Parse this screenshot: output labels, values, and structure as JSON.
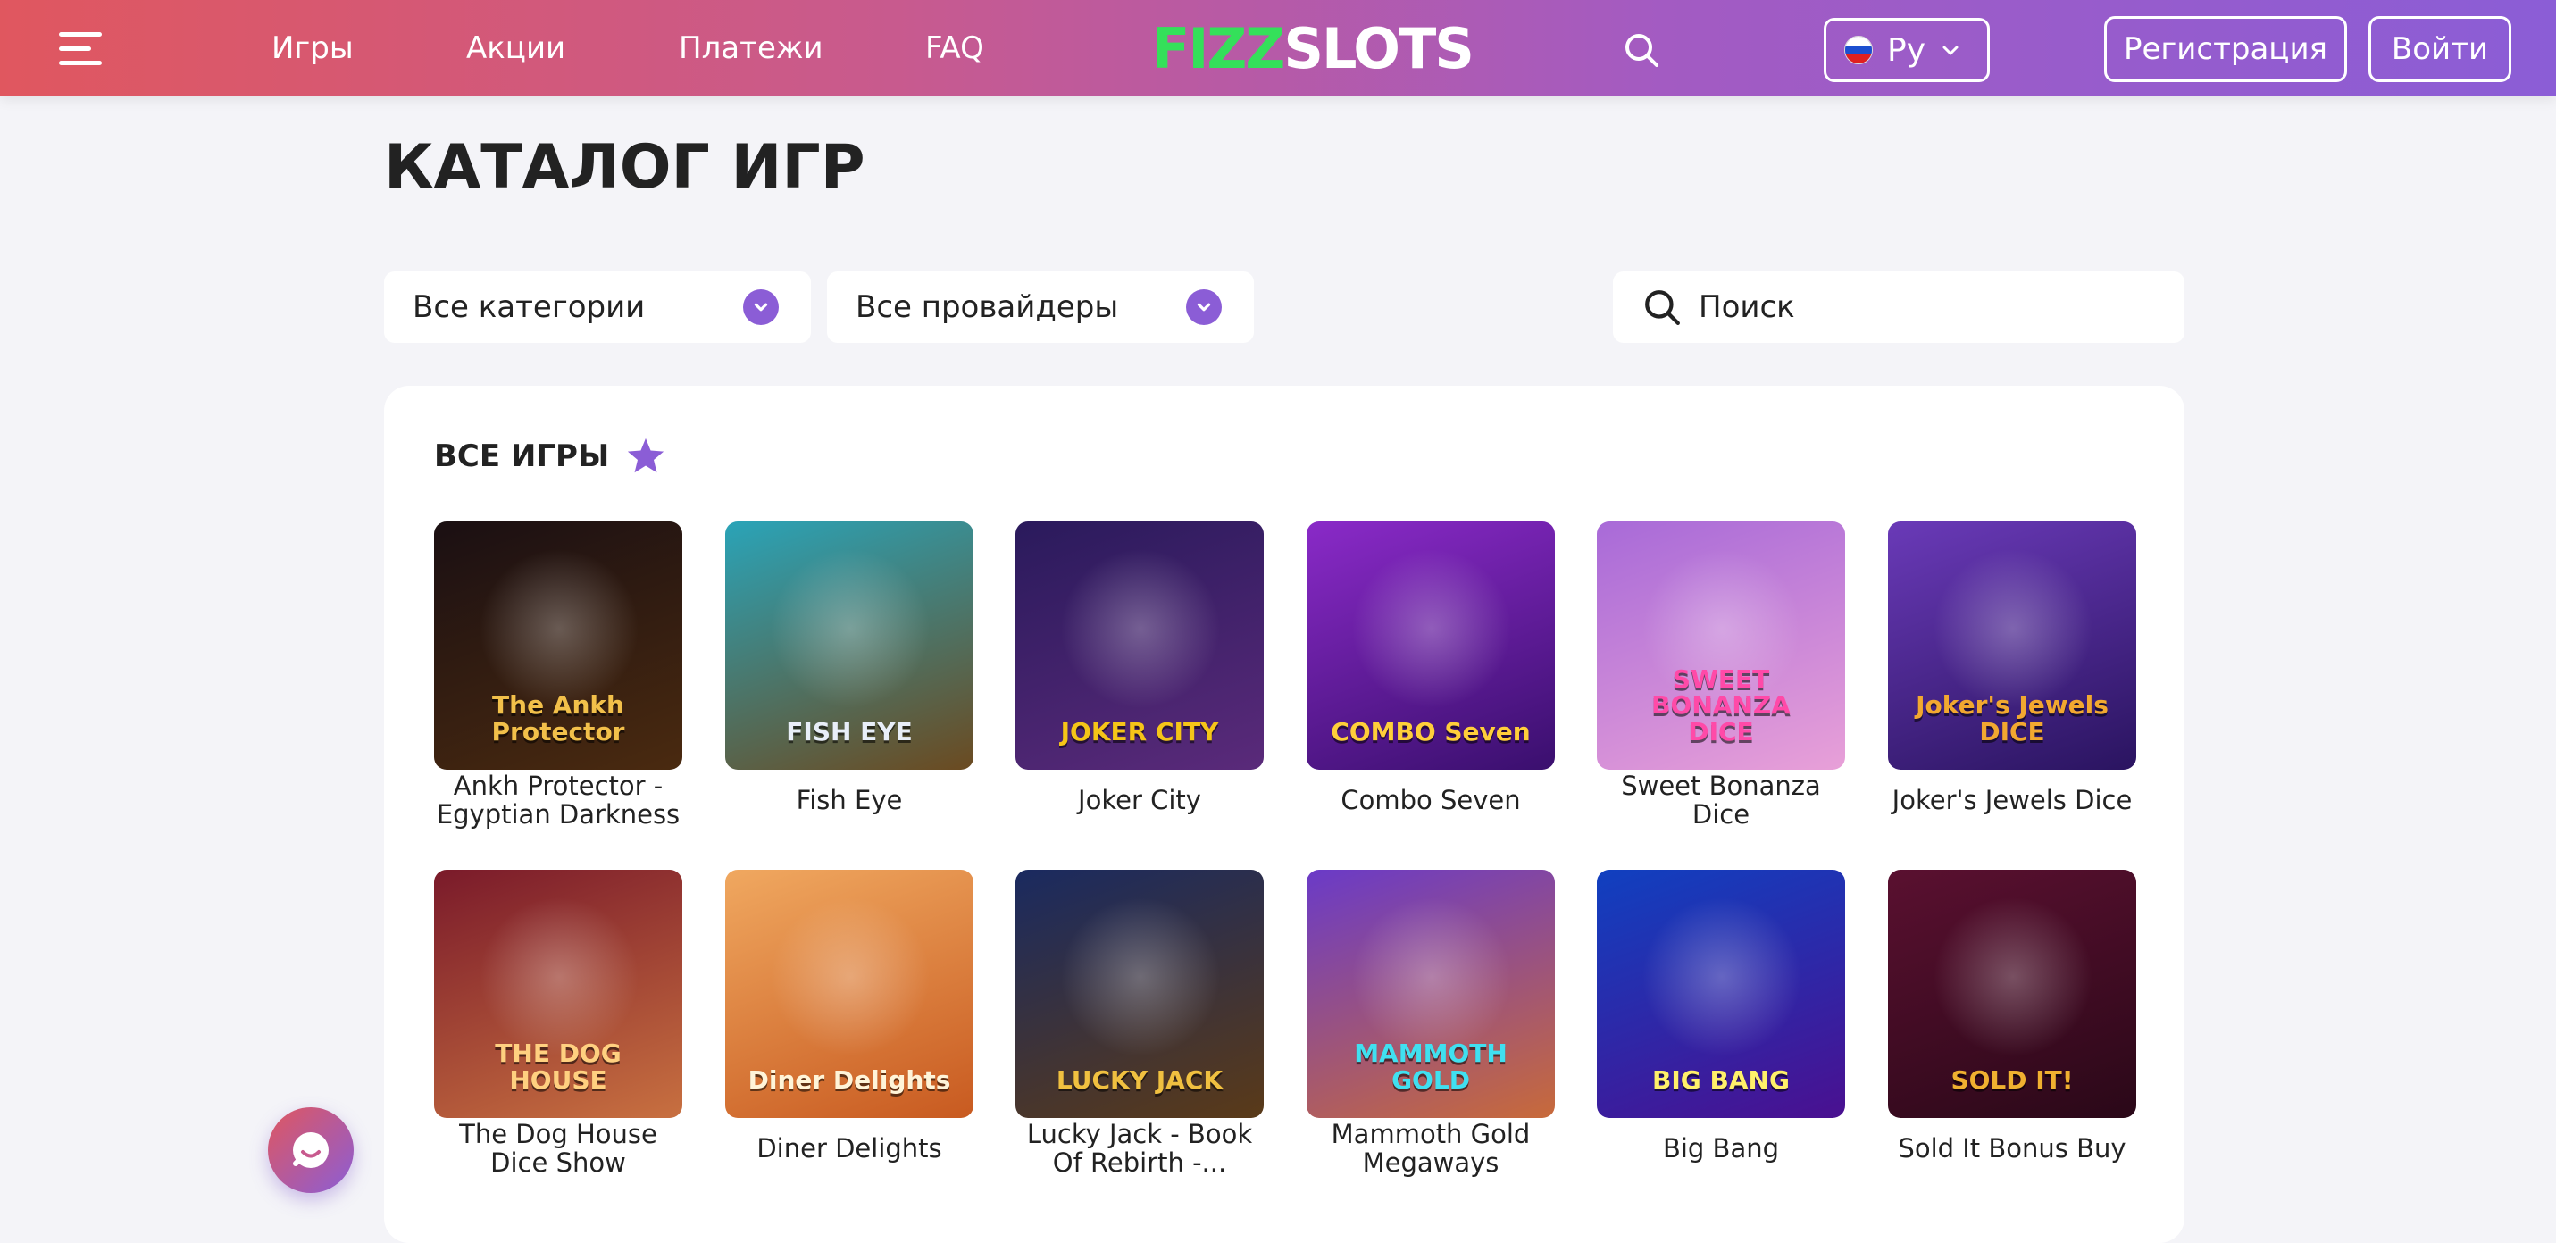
{
  "header": {
    "nav": [
      "Игры",
      "Акции",
      "Платежи",
      "FAQ"
    ],
    "logo_left": "FIZZ",
    "logo_right": "SLOTS",
    "language": "Ру",
    "register_label": "Регистрация",
    "login_label": "Войти"
  },
  "page": {
    "title": "КАТАЛОГ ИГР",
    "category_select": "Все категории",
    "provider_select": "Все провайдеры",
    "search_placeholder": "Поиск"
  },
  "section": {
    "title": "ВСЕ ИГРЫ"
  },
  "games": [
    {
      "name": "Ankh Protector - Egyptian Darkness",
      "art": "The Ankh Protector",
      "bg1": "#1a0f12",
      "bg2": "#4a2a10",
      "fg": "#f2c04a"
    },
    {
      "name": "Fish Eye",
      "art": "FISH EYE",
      "bg1": "#2aa4b8",
      "bg2": "#6b4a20",
      "fg": "#e8eef8"
    },
    {
      "name": "Joker City",
      "art": "JOKER CITY",
      "bg1": "#2a1a5c",
      "bg2": "#5a2a7a",
      "fg": "#f5c518"
    },
    {
      "name": "Combo Seven",
      "art": "COMBO Seven",
      "bg1": "#8a2ac8",
      "bg2": "#3a0f6e",
      "fg": "#ffcf3a"
    },
    {
      "name": "Sweet Bonanza Dice",
      "art": "SWEET BONANZA DICE",
      "bg1": "#a86ad8",
      "bg2": "#e8a0d8",
      "fg": "#ff4aa8"
    },
    {
      "name": "Joker's Jewels Dice",
      "art": "Joker's Jewels DICE",
      "bg1": "#6a3ab8",
      "bg2": "#2a1460",
      "fg": "#f2a830"
    },
    {
      "name": "The Dog House Dice Show",
      "art": "THE DOG HOUSE",
      "bg1": "#7a1a2a",
      "bg2": "#c87040",
      "fg": "#ffd080"
    },
    {
      "name": "Diner Delights",
      "art": "Diner Delights",
      "bg1": "#f0a860",
      "bg2": "#c85a20",
      "fg": "#fff4d8"
    },
    {
      "name": "Lucky Jack - Book Of Rebirth -...",
      "art": "LUCKY JACK",
      "bg1": "#1a2a60",
      "bg2": "#5a3a18",
      "fg": "#f0c040"
    },
    {
      "name": "Mammoth Gold Megaways",
      "art": "MAMMOTH GOLD",
      "bg1": "#6a3ac8",
      "bg2": "#c86a3a",
      "fg": "#40e0f0"
    },
    {
      "name": "Big Bang",
      "art": "BIG BANG",
      "bg1": "#1040c0",
      "bg2": "#4a1090",
      "fg": "#fff06a"
    },
    {
      "name": "Sold It Bonus Buy",
      "art": "SOLD IT!",
      "bg1": "#5a1030",
      "bg2": "#2a0818",
      "fg": "#f0b030"
    }
  ],
  "colors": {
    "header_start": "#e0575f",
    "header_end": "#8b5dd6",
    "accent": "#8b5dd6",
    "logo_green": "#34e05a",
    "page_bg": "#f4f4f8"
  },
  "icons": [
    "menu-icon",
    "search-icon",
    "flag-ru-icon",
    "chevron-down-icon",
    "star-icon",
    "chat-icon"
  ]
}
